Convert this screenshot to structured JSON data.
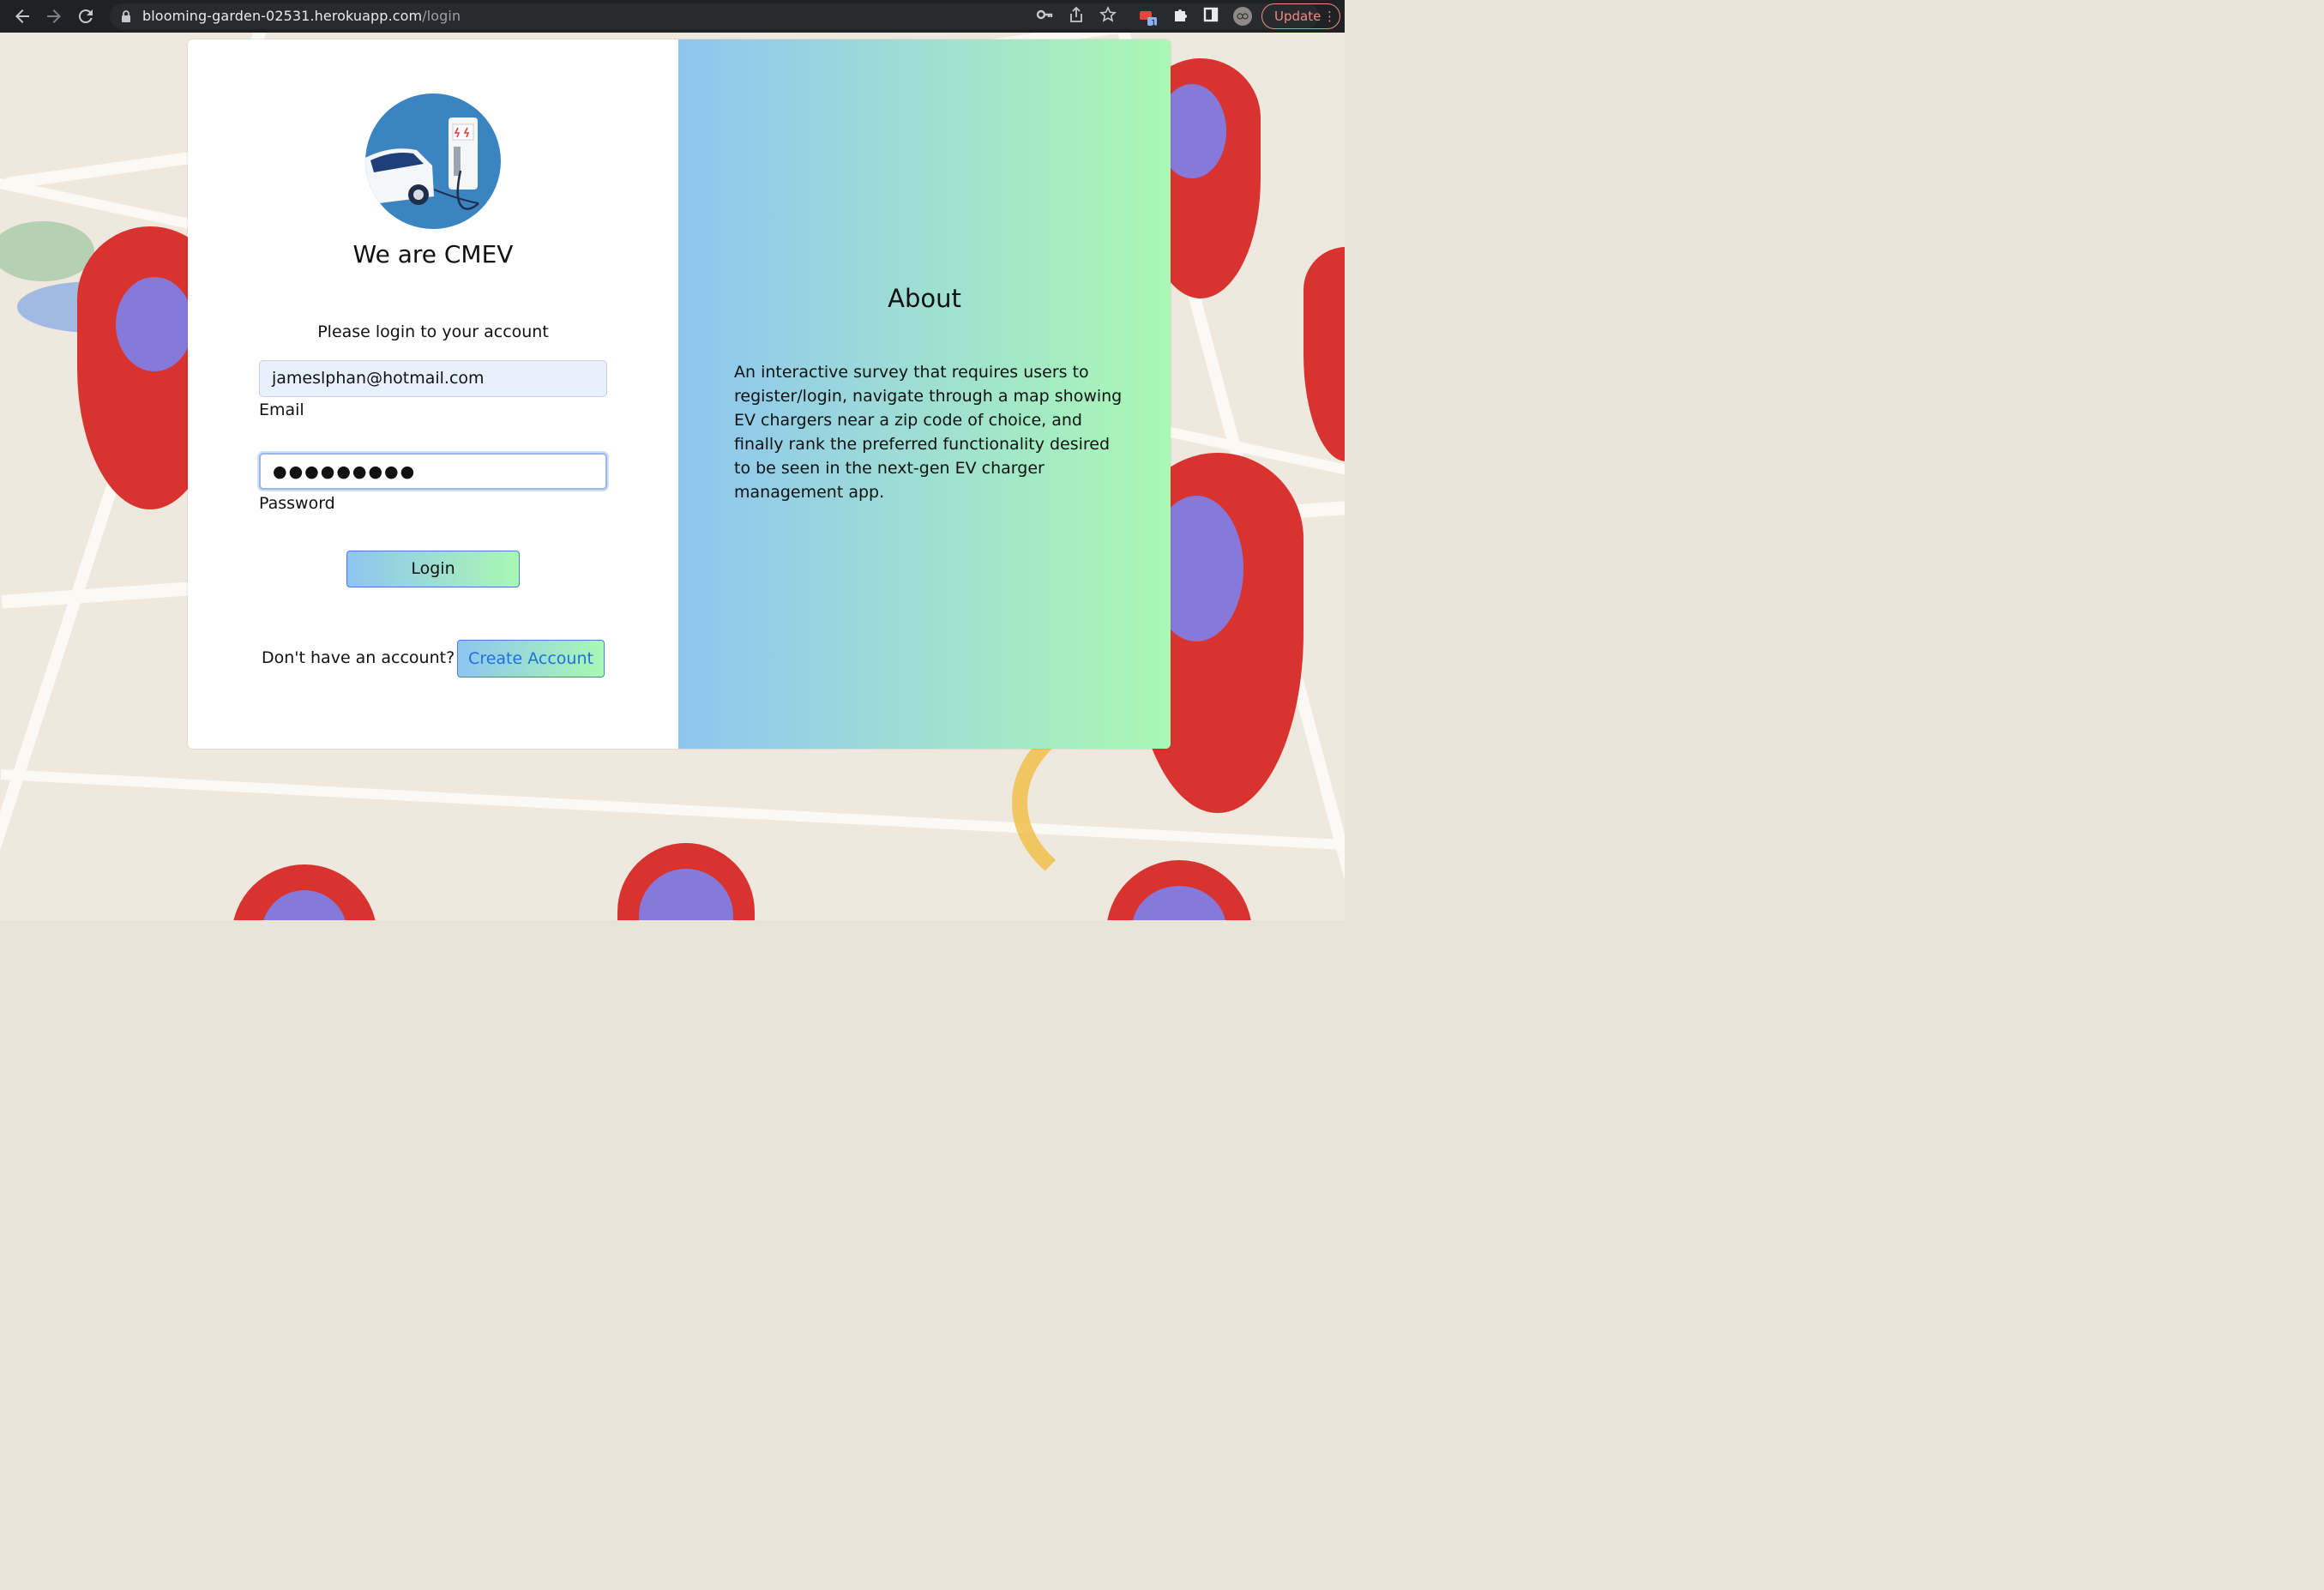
{
  "browser": {
    "back_icon": "back-arrow-icon",
    "forward_icon": "forward-arrow-icon",
    "reload_icon": "reload-icon",
    "url_host": "blooming-garden-02531.herokuapp.com",
    "url_path": "/login",
    "update_label": "Update",
    "extension_badge": "1"
  },
  "login": {
    "brand_title": "We are CMEV",
    "prompt": "Please login to your account",
    "email_value": "jameslphan@hotmail.com",
    "email_label": "Email",
    "password_value": "●●●●●●●●●",
    "password_label": "Password",
    "login_button": "Login",
    "no_account_text": "Don't have an account?",
    "create_account_button": "Create Account"
  },
  "about": {
    "title": "About",
    "description": "An interactive survey that requires users to register/login, navigate through a map showing EV chargers near a zip code of choice, and finally rank the preferred functionality desired to be seen in the next-gen EV charger management app."
  },
  "colors": {
    "gradient_start": "#8ec5f0",
    "gradient_end": "#a9f8b3",
    "link_blue": "#1f6fe0",
    "logo_bg": "#3b84c2"
  }
}
